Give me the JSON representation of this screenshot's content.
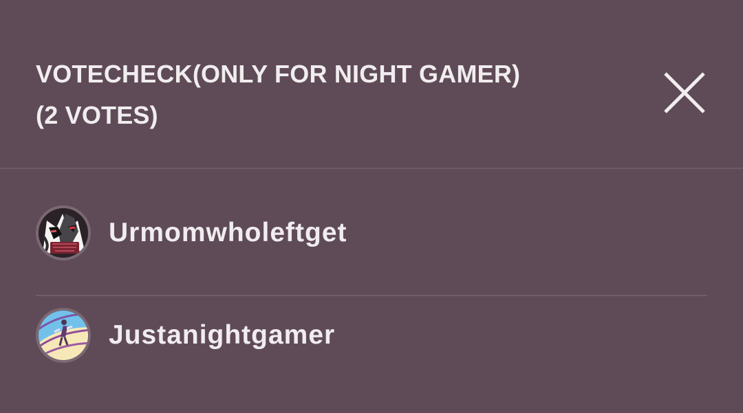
{
  "dialog": {
    "title_line_1": "VOTECHECK(ONLY FOR NIGHT GAMER)",
    "title_line_2": "(2 VOTES)",
    "close_icon": "close-x-icon"
  },
  "voters": [
    {
      "name": "Urmomwholeftget",
      "avatar": "dark-cartoon-character-avatar"
    },
    {
      "name": "Justanightgamer",
      "avatar": "light-blue-drawing-avatar"
    }
  ],
  "colors": {
    "background": "#5f4b57",
    "text": "#f0ecef",
    "divider": "#6f5d68"
  }
}
